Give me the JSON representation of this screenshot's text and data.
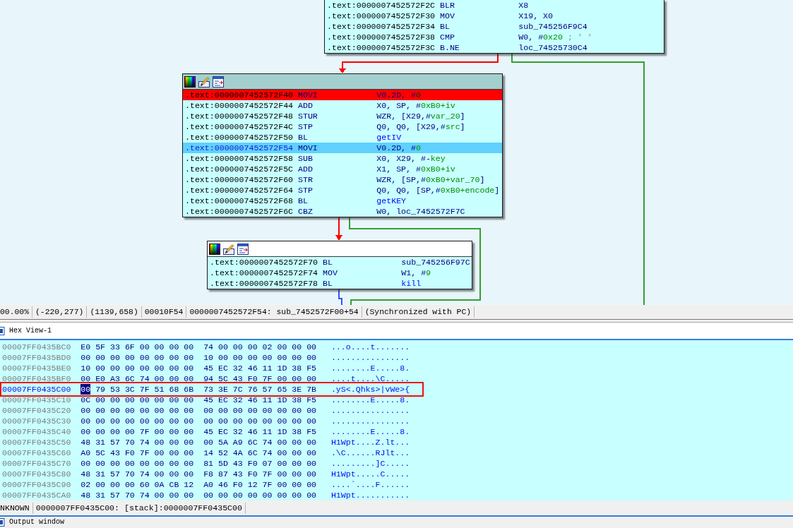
{
  "graph": {
    "blocks": [
      {
        "rows": [
          {
            "address": ".text:0000007452572F2C",
            "mnemonic": "BLR",
            "operands": [
              {
                "text": "X8",
                "kind": "text"
              }
            ],
            "breakpoint": false,
            "current": false
          },
          {
            "address": ".text:0000007452572F30",
            "mnemonic": "MOV",
            "operands": [
              {
                "text": "X19, X0",
                "kind": "text"
              }
            ],
            "breakpoint": false,
            "current": false
          },
          {
            "address": ".text:0000007452572F34",
            "mnemonic": "BL",
            "operands": [
              {
                "text": "sub_745256F9C4",
                "kind": "text"
              }
            ],
            "breakpoint": false,
            "current": false
          },
          {
            "address": ".text:0000007452572F38",
            "mnemonic": "CMP",
            "operands": [
              {
                "text": "W0, #",
                "kind": "text"
              },
              {
                "text": "0x20",
                "kind": "number"
              },
              {
                "text": " ; ' '",
                "kind": "comment"
              }
            ],
            "breakpoint": false,
            "current": false
          },
          {
            "address": ".text:0000007452572F3C",
            "mnemonic": "B.NE",
            "operands": [
              {
                "text": "loc_74525730C4",
                "kind": "text"
              }
            ],
            "breakpoint": false,
            "current": false
          }
        ]
      },
      {
        "header": {
          "selected": true
        },
        "rows": [
          {
            "address": ".text:0000007452572F40",
            "mnemonic": "MOVI",
            "operands": [
              {
                "text": "V0.2D, #",
                "kind": "text"
              },
              {
                "text": "0",
                "kind": "number"
              }
            ],
            "breakpoint": true,
            "current": false
          },
          {
            "address": ".text:0000007452572F44",
            "mnemonic": "ADD",
            "operands": [
              {
                "text": "X0, SP, #",
                "kind": "text"
              },
              {
                "text": "0xB0+iv",
                "kind": "number"
              }
            ],
            "breakpoint": false,
            "current": false
          },
          {
            "address": ".text:0000007452572F48",
            "mnemonic": "STUR",
            "operands": [
              {
                "text": "WZR, [X29,#",
                "kind": "text"
              },
              {
                "text": "var_20",
                "kind": "number"
              },
              {
                "text": "]",
                "kind": "text"
              }
            ],
            "breakpoint": false,
            "current": false
          },
          {
            "address": ".text:0000007452572F4C",
            "mnemonic": "STP",
            "operands": [
              {
                "text": "Q0, Q0, [X29,#",
                "kind": "text"
              },
              {
                "text": "src",
                "kind": "number"
              },
              {
                "text": "]",
                "kind": "text"
              }
            ],
            "breakpoint": false,
            "current": false
          },
          {
            "address": ".text:0000007452572F50",
            "mnemonic": "BL",
            "operands": [
              {
                "text": "getIV",
                "kind": "name"
              }
            ],
            "breakpoint": false,
            "current": false
          },
          {
            "address": ".text:0000007452572F54",
            "mnemonic": "MOVI",
            "operands": [
              {
                "text": "V0.2D, #",
                "kind": "text"
              },
              {
                "text": "0",
                "kind": "number"
              }
            ],
            "breakpoint": false,
            "current": true
          },
          {
            "address": ".text:0000007452572F58",
            "mnemonic": "SUB",
            "operands": [
              {
                "text": "X0, X29, #-",
                "kind": "text"
              },
              {
                "text": "key",
                "kind": "number"
              }
            ],
            "breakpoint": false,
            "current": false
          },
          {
            "address": ".text:0000007452572F5C",
            "mnemonic": "ADD",
            "operands": [
              {
                "text": "X1, SP, #",
                "kind": "text"
              },
              {
                "text": "0xB0+iv",
                "kind": "number"
              }
            ],
            "breakpoint": false,
            "current": false
          },
          {
            "address": ".text:0000007452572F60",
            "mnemonic": "STR",
            "operands": [
              {
                "text": "WZR, [SP,#",
                "kind": "text"
              },
              {
                "text": "0xB0+var_70",
                "kind": "number"
              },
              {
                "text": "]",
                "kind": "text"
              }
            ],
            "breakpoint": false,
            "current": false
          },
          {
            "address": ".text:0000007452572F64",
            "mnemonic": "STP",
            "operands": [
              {
                "text": "Q0, Q0, [SP,#",
                "kind": "text"
              },
              {
                "text": "0xB0+encode",
                "kind": "number"
              },
              {
                "text": "]",
                "kind": "text"
              }
            ],
            "breakpoint": false,
            "current": false
          },
          {
            "address": ".text:0000007452572F68",
            "mnemonic": "BL",
            "operands": [
              {
                "text": "getKEY",
                "kind": "name"
              }
            ],
            "breakpoint": false,
            "current": false
          },
          {
            "address": ".text:0000007452572F6C",
            "mnemonic": "CBZ",
            "operands": [
              {
                "text": "W0, loc_7452572F7C",
                "kind": "text"
              }
            ],
            "breakpoint": false,
            "current": false
          }
        ]
      },
      {
        "header": {
          "selected": false
        },
        "rows": [
          {
            "address": ".text:0000007452572F70",
            "mnemonic": "BL",
            "operands": [
              {
                "text": "sub_745256F97C",
                "kind": "text"
              }
            ],
            "breakpoint": false,
            "current": false
          },
          {
            "address": ".text:0000007452572F74",
            "mnemonic": "MOV",
            "operands": [
              {
                "text": "W1, #",
                "kind": "text"
              },
              {
                "text": "9",
                "kind": "number"
              }
            ],
            "breakpoint": false,
            "current": false
          },
          {
            "address": ".text:0000007452572F78",
            "mnemonic": "BL",
            "operands": [
              {
                "text": "kill",
                "kind": "name"
              }
            ],
            "breakpoint": false,
            "current": false
          }
        ]
      }
    ],
    "edges": [
      {
        "color": "#ff0000"
      },
      {
        "color": "#33a033"
      },
      {
        "color": "#ff0000"
      },
      {
        "color": "#33a033"
      },
      {
        "color": "#3355ff"
      }
    ]
  },
  "graph_status": {
    "fields": [
      "00.00%",
      "(-220,277)",
      "(1139,658)",
      "00010F54",
      "0000007452572F54: sub_7452572F00+54",
      "(Synchronized with PC)"
    ]
  },
  "hex_view": {
    "tab": "Hex View-1",
    "rows": [
      {
        "address": "00007FF0435BC0",
        "current": false,
        "marked": false,
        "bytes": [
          {
            "hex": "E0",
            "selected": false
          },
          {
            "hex": "5F",
            "selected": false
          },
          {
            "hex": "33",
            "selected": false
          },
          {
            "hex": "6F",
            "selected": false
          },
          {
            "hex": "00",
            "selected": false
          },
          {
            "hex": "00",
            "selected": false
          },
          {
            "hex": "00",
            "selected": false
          },
          {
            "hex": "00",
            "selected": false
          },
          {
            "hex": "74",
            "selected": false
          },
          {
            "hex": "00",
            "selected": false
          },
          {
            "hex": "00",
            "selected": false
          },
          {
            "hex": "00",
            "selected": false
          },
          {
            "hex": "02",
            "selected": false
          },
          {
            "hex": "00",
            "selected": false
          },
          {
            "hex": "00",
            "selected": false
          },
          {
            "hex": "00",
            "selected": false
          }
        ],
        "ascii": "...o....t......."
      },
      {
        "address": "00007FF0435BD0",
        "current": false,
        "marked": false,
        "bytes": [
          {
            "hex": "00",
            "selected": false
          },
          {
            "hex": "00",
            "selected": false
          },
          {
            "hex": "00",
            "selected": false
          },
          {
            "hex": "00",
            "selected": false
          },
          {
            "hex": "00",
            "selected": false
          },
          {
            "hex": "00",
            "selected": false
          },
          {
            "hex": "00",
            "selected": false
          },
          {
            "hex": "00",
            "selected": false
          },
          {
            "hex": "10",
            "selected": false
          },
          {
            "hex": "00",
            "selected": false
          },
          {
            "hex": "00",
            "selected": false
          },
          {
            "hex": "00",
            "selected": false
          },
          {
            "hex": "00",
            "selected": false
          },
          {
            "hex": "00",
            "selected": false
          },
          {
            "hex": "00",
            "selected": false
          },
          {
            "hex": "00",
            "selected": false
          }
        ],
        "ascii": "................"
      },
      {
        "address": "00007FF0435BE0",
        "current": false,
        "marked": false,
        "bytes": [
          {
            "hex": "10",
            "selected": false
          },
          {
            "hex": "00",
            "selected": false
          },
          {
            "hex": "00",
            "selected": false
          },
          {
            "hex": "00",
            "selected": false
          },
          {
            "hex": "00",
            "selected": false
          },
          {
            "hex": "00",
            "selected": false
          },
          {
            "hex": "00",
            "selected": false
          },
          {
            "hex": "00",
            "selected": false
          },
          {
            "hex": "45",
            "selected": false
          },
          {
            "hex": "EC",
            "selected": false
          },
          {
            "hex": "32",
            "selected": false
          },
          {
            "hex": "46",
            "selected": false
          },
          {
            "hex": "11",
            "selected": false
          },
          {
            "hex": "1D",
            "selected": false
          },
          {
            "hex": "38",
            "selected": false
          },
          {
            "hex": "F5",
            "selected": false
          }
        ],
        "ascii": "........E.....8."
      },
      {
        "address": "00007FF0435BF0",
        "current": false,
        "marked": false,
        "bytes": [
          {
            "hex": "00",
            "selected": false
          },
          {
            "hex": "E0",
            "selected": false
          },
          {
            "hex": "A3",
            "selected": false
          },
          {
            "hex": "6C",
            "selected": false
          },
          {
            "hex": "74",
            "selected": false
          },
          {
            "hex": "00",
            "selected": false
          },
          {
            "hex": "00",
            "selected": false
          },
          {
            "hex": "00",
            "selected": false
          },
          {
            "hex": "94",
            "selected": false
          },
          {
            "hex": "5C",
            "selected": false
          },
          {
            "hex": "43",
            "selected": false
          },
          {
            "hex": "F0",
            "selected": false
          },
          {
            "hex": "7F",
            "selected": false
          },
          {
            "hex": "00",
            "selected": false
          },
          {
            "hex": "00",
            "selected": false
          },
          {
            "hex": "00",
            "selected": false
          }
        ],
        "ascii": "....t....\\C....."
      },
      {
        "address": "00007FF0435C00",
        "current": true,
        "marked": true,
        "bytes": [
          {
            "hex": "00",
            "selected": true
          },
          {
            "hex": "79",
            "selected": false
          },
          {
            "hex": "53",
            "selected": false
          },
          {
            "hex": "3C",
            "selected": false
          },
          {
            "hex": "7F",
            "selected": false
          },
          {
            "hex": "51",
            "selected": false
          },
          {
            "hex": "68",
            "selected": false
          },
          {
            "hex": "6B",
            "selected": false
          },
          {
            "hex": "73",
            "selected": false
          },
          {
            "hex": "3E",
            "selected": false
          },
          {
            "hex": "7C",
            "selected": false
          },
          {
            "hex": "76",
            "selected": false
          },
          {
            "hex": "57",
            "selected": false
          },
          {
            "hex": "65",
            "selected": false
          },
          {
            "hex": "3E",
            "selected": false
          },
          {
            "hex": "7B",
            "selected": false
          }
        ],
        "ascii": ".yS<.Qhks>|vWe>{"
      },
      {
        "address": "00007FF0435C10",
        "current": false,
        "marked": false,
        "bytes": [
          {
            "hex": "0C",
            "selected": false
          },
          {
            "hex": "00",
            "selected": false
          },
          {
            "hex": "00",
            "selected": false
          },
          {
            "hex": "00",
            "selected": false
          },
          {
            "hex": "00",
            "selected": false
          },
          {
            "hex": "00",
            "selected": false
          },
          {
            "hex": "00",
            "selected": false
          },
          {
            "hex": "00",
            "selected": false
          },
          {
            "hex": "45",
            "selected": false
          },
          {
            "hex": "EC",
            "selected": false
          },
          {
            "hex": "32",
            "selected": false
          },
          {
            "hex": "46",
            "selected": false
          },
          {
            "hex": "11",
            "selected": false
          },
          {
            "hex": "1D",
            "selected": false
          },
          {
            "hex": "38",
            "selected": false
          },
          {
            "hex": "F5",
            "selected": false
          }
        ],
        "ascii": "........E.....8."
      },
      {
        "address": "00007FF0435C20",
        "current": false,
        "marked": false,
        "bytes": [
          {
            "hex": "00",
            "selected": false
          },
          {
            "hex": "00",
            "selected": false
          },
          {
            "hex": "00",
            "selected": false
          },
          {
            "hex": "00",
            "selected": false
          },
          {
            "hex": "00",
            "selected": false
          },
          {
            "hex": "00",
            "selected": false
          },
          {
            "hex": "00",
            "selected": false
          },
          {
            "hex": "00",
            "selected": false
          },
          {
            "hex": "00",
            "selected": false
          },
          {
            "hex": "00",
            "selected": false
          },
          {
            "hex": "00",
            "selected": false
          },
          {
            "hex": "00",
            "selected": false
          },
          {
            "hex": "00",
            "selected": false
          },
          {
            "hex": "00",
            "selected": false
          },
          {
            "hex": "00",
            "selected": false
          },
          {
            "hex": "00",
            "selected": false
          }
        ],
        "ascii": "................"
      },
      {
        "address": "00007FF0435C30",
        "current": false,
        "marked": false,
        "bytes": [
          {
            "hex": "00",
            "selected": false
          },
          {
            "hex": "00",
            "selected": false
          },
          {
            "hex": "00",
            "selected": false
          },
          {
            "hex": "00",
            "selected": false
          },
          {
            "hex": "00",
            "selected": false
          },
          {
            "hex": "00",
            "selected": false
          },
          {
            "hex": "00",
            "selected": false
          },
          {
            "hex": "00",
            "selected": false
          },
          {
            "hex": "00",
            "selected": false
          },
          {
            "hex": "00",
            "selected": false
          },
          {
            "hex": "00",
            "selected": false
          },
          {
            "hex": "00",
            "selected": false
          },
          {
            "hex": "00",
            "selected": false
          },
          {
            "hex": "00",
            "selected": false
          },
          {
            "hex": "00",
            "selected": false
          },
          {
            "hex": "00",
            "selected": false
          }
        ],
        "ascii": "................"
      },
      {
        "address": "00007FF0435C40",
        "current": false,
        "marked": false,
        "bytes": [
          {
            "hex": "00",
            "selected": false
          },
          {
            "hex": "00",
            "selected": false
          },
          {
            "hex": "00",
            "selected": false
          },
          {
            "hex": "00",
            "selected": false
          },
          {
            "hex": "7F",
            "selected": false
          },
          {
            "hex": "00",
            "selected": false
          },
          {
            "hex": "00",
            "selected": false
          },
          {
            "hex": "00",
            "selected": false
          },
          {
            "hex": "45",
            "selected": false
          },
          {
            "hex": "EC",
            "selected": false
          },
          {
            "hex": "32",
            "selected": false
          },
          {
            "hex": "46",
            "selected": false
          },
          {
            "hex": "11",
            "selected": false
          },
          {
            "hex": "1D",
            "selected": false
          },
          {
            "hex": "38",
            "selected": false
          },
          {
            "hex": "F5",
            "selected": false
          }
        ],
        "ascii": "........E.....8."
      },
      {
        "address": "00007FF0435C50",
        "current": false,
        "marked": false,
        "bytes": [
          {
            "hex": "48",
            "selected": false
          },
          {
            "hex": "31",
            "selected": false
          },
          {
            "hex": "57",
            "selected": false
          },
          {
            "hex": "70",
            "selected": false
          },
          {
            "hex": "74",
            "selected": false
          },
          {
            "hex": "00",
            "selected": false
          },
          {
            "hex": "00",
            "selected": false
          },
          {
            "hex": "00",
            "selected": false
          },
          {
            "hex": "00",
            "selected": false
          },
          {
            "hex": "5A",
            "selected": false
          },
          {
            "hex": "A9",
            "selected": false
          },
          {
            "hex": "6C",
            "selected": false
          },
          {
            "hex": "74",
            "selected": false
          },
          {
            "hex": "00",
            "selected": false
          },
          {
            "hex": "00",
            "selected": false
          },
          {
            "hex": "00",
            "selected": false
          }
        ],
        "ascii": "H1Wpt....Z.lt..."
      },
      {
        "address": "00007FF0435C60",
        "current": false,
        "marked": false,
        "bytes": [
          {
            "hex": "A0",
            "selected": false
          },
          {
            "hex": "5C",
            "selected": false
          },
          {
            "hex": "43",
            "selected": false
          },
          {
            "hex": "F0",
            "selected": false
          },
          {
            "hex": "7F",
            "selected": false
          },
          {
            "hex": "00",
            "selected": false
          },
          {
            "hex": "00",
            "selected": false
          },
          {
            "hex": "00",
            "selected": false
          },
          {
            "hex": "14",
            "selected": false
          },
          {
            "hex": "52",
            "selected": false
          },
          {
            "hex": "4A",
            "selected": false
          },
          {
            "hex": "6C",
            "selected": false
          },
          {
            "hex": "74",
            "selected": false
          },
          {
            "hex": "00",
            "selected": false
          },
          {
            "hex": "00",
            "selected": false
          },
          {
            "hex": "00",
            "selected": false
          }
        ],
        "ascii": ".\\C......RJlt..."
      },
      {
        "address": "00007FF0435C70",
        "current": false,
        "marked": false,
        "bytes": [
          {
            "hex": "00",
            "selected": false
          },
          {
            "hex": "00",
            "selected": false
          },
          {
            "hex": "00",
            "selected": false
          },
          {
            "hex": "00",
            "selected": false
          },
          {
            "hex": "00",
            "selected": false
          },
          {
            "hex": "00",
            "selected": false
          },
          {
            "hex": "00",
            "selected": false
          },
          {
            "hex": "00",
            "selected": false
          },
          {
            "hex": "81",
            "selected": false
          },
          {
            "hex": "5D",
            "selected": false
          },
          {
            "hex": "43",
            "selected": false
          },
          {
            "hex": "F0",
            "selected": false
          },
          {
            "hex": "07",
            "selected": false
          },
          {
            "hex": "00",
            "selected": false
          },
          {
            "hex": "00",
            "selected": false
          },
          {
            "hex": "00",
            "selected": false
          }
        ],
        "ascii": ".........]C....."
      },
      {
        "address": "00007FF0435C80",
        "current": false,
        "marked": false,
        "bytes": [
          {
            "hex": "48",
            "selected": false
          },
          {
            "hex": "31",
            "selected": false
          },
          {
            "hex": "57",
            "selected": false
          },
          {
            "hex": "70",
            "selected": false
          },
          {
            "hex": "74",
            "selected": false
          },
          {
            "hex": "00",
            "selected": false
          },
          {
            "hex": "00",
            "selected": false
          },
          {
            "hex": "00",
            "selected": false
          },
          {
            "hex": "F8",
            "selected": false
          },
          {
            "hex": "87",
            "selected": false
          },
          {
            "hex": "43",
            "selected": false
          },
          {
            "hex": "F0",
            "selected": false
          },
          {
            "hex": "7F",
            "selected": false
          },
          {
            "hex": "00",
            "selected": false
          },
          {
            "hex": "00",
            "selected": false
          },
          {
            "hex": "00",
            "selected": false
          }
        ],
        "ascii": "H1Wpt.....C....."
      },
      {
        "address": "00007FF0435C90",
        "current": false,
        "marked": false,
        "bytes": [
          {
            "hex": "02",
            "selected": false
          },
          {
            "hex": "00",
            "selected": false
          },
          {
            "hex": "00",
            "selected": false
          },
          {
            "hex": "00",
            "selected": false
          },
          {
            "hex": "60",
            "selected": false
          },
          {
            "hex": "0A",
            "selected": false
          },
          {
            "hex": "CB",
            "selected": false
          },
          {
            "hex": "12",
            "selected": false
          },
          {
            "hex": "A0",
            "selected": false
          },
          {
            "hex": "46",
            "selected": false
          },
          {
            "hex": "F0",
            "selected": false
          },
          {
            "hex": "12",
            "selected": false
          },
          {
            "hex": "7F",
            "selected": false
          },
          {
            "hex": "00",
            "selected": false
          },
          {
            "hex": "00",
            "selected": false
          },
          {
            "hex": "00",
            "selected": false
          }
        ],
        "ascii": "....`....F......"
      },
      {
        "address": "00007FF0435CA0",
        "current": false,
        "marked": false,
        "bytes": [
          {
            "hex": "48",
            "selected": false
          },
          {
            "hex": "31",
            "selected": false
          },
          {
            "hex": "57",
            "selected": false
          },
          {
            "hex": "70",
            "selected": false
          },
          {
            "hex": "74",
            "selected": false
          },
          {
            "hex": "00",
            "selected": false
          },
          {
            "hex": "00",
            "selected": false
          },
          {
            "hex": "00",
            "selected": false
          },
          {
            "hex": "00",
            "selected": false
          },
          {
            "hex": "00",
            "selected": false
          },
          {
            "hex": "00",
            "selected": false
          },
          {
            "hex": "00",
            "selected": false
          },
          {
            "hex": "00",
            "selected": false
          },
          {
            "hex": "00",
            "selected": false
          },
          {
            "hex": "00",
            "selected": false
          },
          {
            "hex": "00",
            "selected": false
          }
        ],
        "ascii": "H1Wpt..........."
      }
    ],
    "status": {
      "fields": [
        "NKNOWN",
        "0000007FF0435C00: [stack]:0000007FF0435C00"
      ]
    }
  },
  "output_window": {
    "tab": "Output window"
  }
}
